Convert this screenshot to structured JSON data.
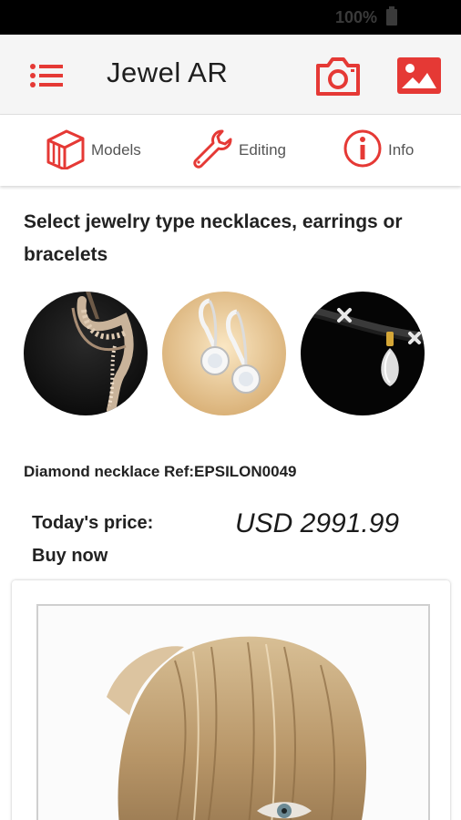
{
  "status_bar": {
    "battery": "100%"
  },
  "app_bar": {
    "title": "Jewel AR",
    "icons": {
      "menu": "menu-icon",
      "camera": "camera-icon",
      "gallery": "gallery-icon"
    },
    "accent_color": "#e53935"
  },
  "tabs": [
    {
      "label": "Models",
      "icon": "models-icon"
    },
    {
      "label": "Editing",
      "icon": "wrench-icon"
    },
    {
      "label": "Info",
      "icon": "info-icon"
    }
  ],
  "content": {
    "section_title": "Select jewelry type necklaces, earrings or bracelets",
    "thumbnails": [
      {
        "type": "necklace"
      },
      {
        "type": "earrings"
      },
      {
        "type": "bracelet"
      }
    ],
    "product_name": "Diamond necklace Ref:EPSILON0049",
    "price_label_line1": "Today's price:",
    "price_label_line2": "Buy now",
    "price_value": "USD 2991.99"
  }
}
